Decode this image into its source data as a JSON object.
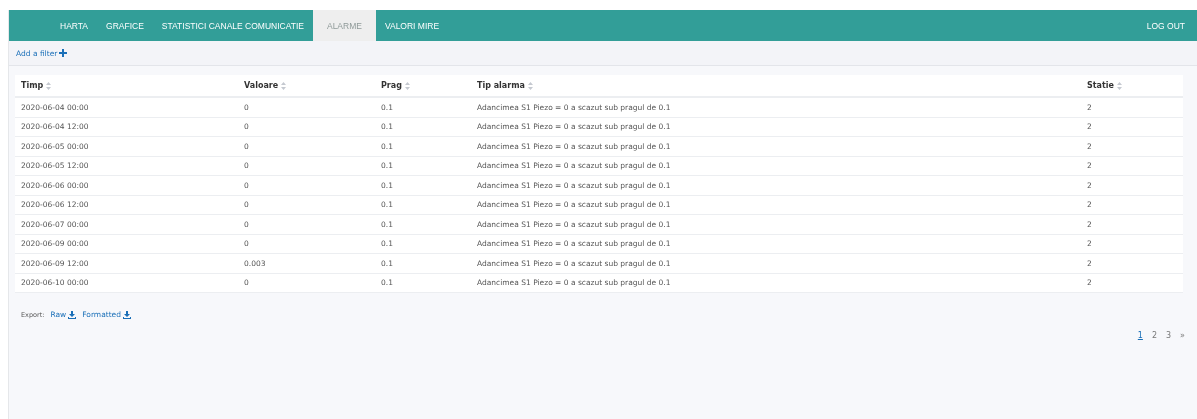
{
  "nav": {
    "tabs": [
      {
        "label": "HARTA",
        "selected": false
      },
      {
        "label": "GRAFICE",
        "selected": false
      },
      {
        "label": "STATISTICI CANALE COMUNICATIE",
        "selected": false
      },
      {
        "label": "ALARME",
        "selected": true
      },
      {
        "label": "VALORI MIRE",
        "selected": false
      }
    ],
    "logout": "LOG OUT"
  },
  "filter": {
    "label": "Add a filter"
  },
  "table": {
    "columns": [
      "Timp",
      "Valoare",
      "Prag",
      "Tip alarma",
      "Statie"
    ],
    "rows": [
      [
        "2020-06-04 00:00",
        "0",
        "0.1",
        "Adancimea S1 Piezo = 0 a scazut sub pragul de 0.1",
        "2"
      ],
      [
        "2020-06-04 12:00",
        "0",
        "0.1",
        "Adancimea S1 Piezo = 0 a scazut sub pragul de 0.1",
        "2"
      ],
      [
        "2020-06-05 00:00",
        "0",
        "0.1",
        "Adancimea S1 Piezo = 0 a scazut sub pragul de 0.1",
        "2"
      ],
      [
        "2020-06-05 12:00",
        "0",
        "0.1",
        "Adancimea S1 Piezo = 0 a scazut sub pragul de 0.1",
        "2"
      ],
      [
        "2020-06-06 00:00",
        "0",
        "0.1",
        "Adancimea S1 Piezo = 0 a scazut sub pragul de 0.1",
        "2"
      ],
      [
        "2020-06-06 12:00",
        "0",
        "0.1",
        "Adancimea S1 Piezo = 0 a scazut sub pragul de 0.1",
        "2"
      ],
      [
        "2020-06-07 00:00",
        "0",
        "0.1",
        "Adancimea S1 Piezo = 0 a scazut sub pragul de 0.1",
        "2"
      ],
      [
        "2020-06-09 00:00",
        "0",
        "0.1",
        "Adancimea S1 Piezo = 0 a scazut sub pragul de 0.1",
        "2"
      ],
      [
        "2020-06-09 12:00",
        "0.003",
        "0.1",
        "Adancimea S1 Piezo = 0 a scazut sub pragul de 0.1",
        "2"
      ],
      [
        "2020-06-10 00:00",
        "0",
        "0.1",
        "Adancimea S1 Piezo = 0 a scazut sub pragul de 0.1",
        "2"
      ]
    ]
  },
  "export": {
    "label": "Export:",
    "links": [
      "Raw",
      "Formatted"
    ]
  },
  "pagination": {
    "pages": [
      {
        "label": "1",
        "selected": true
      },
      {
        "label": "2",
        "selected": false
      },
      {
        "label": "3",
        "selected": false
      }
    ],
    "next": "»"
  }
}
